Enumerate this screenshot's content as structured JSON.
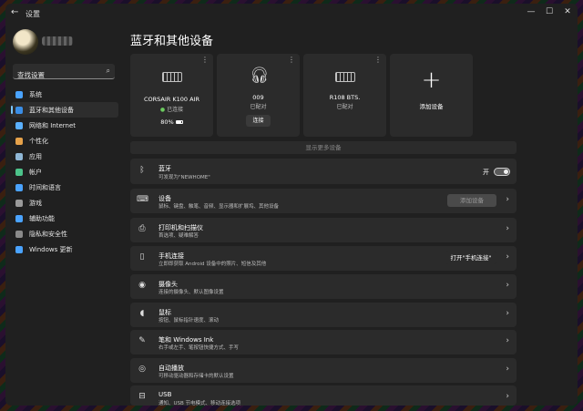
{
  "app_title": "设置",
  "window_controls": [
    "—",
    "☐",
    "✕"
  ],
  "sidebar": {
    "search": {
      "placeholder": "查找设置"
    },
    "items": [
      {
        "label": "系统",
        "color": "#4aa3ff"
      },
      {
        "label": "蓝牙和其他设备",
        "color": "#3a8ee6",
        "active": true
      },
      {
        "label": "网络和 Internet",
        "color": "#5ab0ff"
      },
      {
        "label": "个性化",
        "color": "#e6a24a"
      },
      {
        "label": "应用",
        "color": "#8fb7d6"
      },
      {
        "label": "帐户",
        "color": "#4cc38a"
      },
      {
        "label": "时间和语言",
        "color": "#4aa3ff"
      },
      {
        "label": "游戏",
        "color": "#9a9a9a"
      },
      {
        "label": "辅助功能",
        "color": "#4aa3ff"
      },
      {
        "label": "隐私和安全性",
        "color": "#8a8a8a"
      },
      {
        "label": "Windows 更新",
        "color": "#4aa3ff"
      }
    ]
  },
  "main": {
    "title": "蓝牙和其他设备",
    "cards": [
      {
        "name": "CORSAIR K100 AIR",
        "status": "已连接",
        "battery": "80%"
      },
      {
        "name": "009",
        "status": "已配对",
        "button": "连接"
      },
      {
        "name": "R108 BTS.",
        "status": "已配对"
      },
      {
        "name": "添加设备"
      }
    ],
    "show_more": "显示更多设备",
    "bluetooth": {
      "title": "蓝牙",
      "subtitle": "可发现为\"NEWHOME\"",
      "state": "开"
    },
    "rows": [
      {
        "title": "设备",
        "subtitle": "鼠标、键盘、触笔、音频、显示器和扩展坞、其他设备",
        "button": "添加设备"
      },
      {
        "title": "打印机和扫描仪",
        "subtitle": "首选项、疑难解答"
      },
      {
        "title": "手机连接",
        "subtitle": "立即即获取 Android 设备中的照片、短信及其他",
        "button": "打开\"手机连接\""
      },
      {
        "title": "摄像头",
        "subtitle": "连接的摄像头、默认图像设置"
      },
      {
        "title": "鼠标",
        "subtitle": "按钮、鼠标指针速度、滚动"
      },
      {
        "title": "笔和 Windows Ink",
        "subtitle": "右手或左手、笔按钮快捷方式、手写"
      },
      {
        "title": "自动播放",
        "subtitle": "可移动驱动器和存储卡的默认设置"
      },
      {
        "title": "USB",
        "subtitle": "通知、USB 节电模式、移动连接选项"
      }
    ]
  }
}
